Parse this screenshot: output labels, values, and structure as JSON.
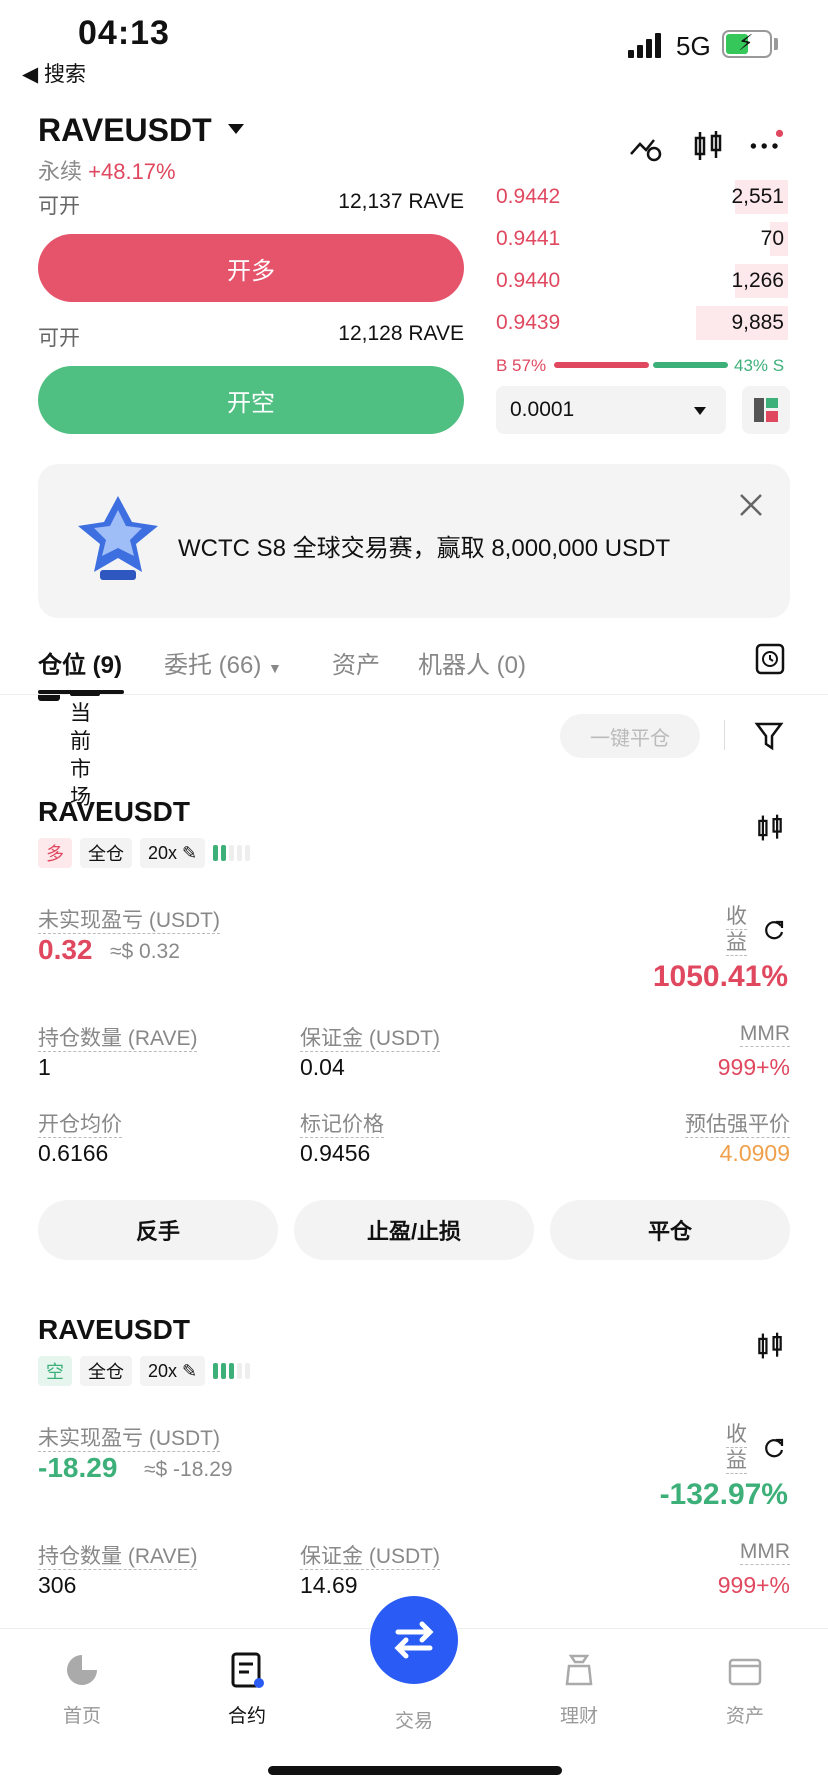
{
  "status_bar": {
    "time": "04:13",
    "back": "◀ 搜索",
    "network": "5G"
  },
  "header": {
    "symbol": "RAVEUSDT",
    "type": "永续",
    "change": "+48.17%"
  },
  "trade": {
    "open_long": {
      "label": "可开",
      "value": "12,137 RAVE",
      "button": "开多"
    },
    "open_short": {
      "label": "可开",
      "value": "12,128 RAVE",
      "button": "开空"
    }
  },
  "orderbook": {
    "asks": [
      {
        "price": "0.9442",
        "qty": "2,551",
        "depth": 0.18
      },
      {
        "price": "0.9441",
        "qty": "70",
        "depth": 0.06
      },
      {
        "price": "0.9440",
        "qty": "1,266",
        "depth": 0.18
      },
      {
        "price": "0.9439",
        "qty": "9,885",
        "depth": 0.31
      }
    ],
    "buy_ratio": "B 57%",
    "sell_ratio": "43% S",
    "buy_pct": 57,
    "precision": "0.0001"
  },
  "banner": {
    "text": "WCTC S8 全球交易赛，赢取 8,000,000 USDT"
  },
  "tabs": [
    "仓位 (9)",
    "委托 (66)",
    "资产",
    "机器人 (0)"
  ],
  "filter": {
    "label": "当前市场",
    "close_all": "一键平仓"
  },
  "positions": [
    {
      "symbol": "RAVEUSDT",
      "side": "多",
      "margin_mode": "全仓",
      "leverage": "20x",
      "pnl_label": "未实现盈亏 (USDT)",
      "pnl": "0.32",
      "pnl_usd": "≈$ 0.32",
      "roe_label": "收益",
      "roe": "1050.41%",
      "qty_label": "持仓数量 (RAVE)",
      "qty": "1",
      "margin_label": "保证金 (USDT)",
      "margin": "0.04",
      "mmr_label": "MMR",
      "mmr": "999+%",
      "entry_label": "开仓均价",
      "entry": "0.6166",
      "mark_label": "标记价格",
      "mark": "0.9456",
      "liq_label": "预估强平价",
      "liq": "4.0909",
      "actions": [
        "反手",
        "止盈/止损",
        "平仓"
      ]
    },
    {
      "symbol": "RAVEUSDT",
      "side": "空",
      "margin_mode": "全仓",
      "leverage": "20x",
      "pnl_label": "未实现盈亏 (USDT)",
      "pnl": "-18.29",
      "pnl_usd": "≈$ -18.29",
      "roe_label": "收益",
      "roe": "-132.97%",
      "qty_label": "持仓数量 (RAVE)",
      "qty": "306",
      "margin_label": "保证金 (USDT)",
      "margin": "14.69",
      "mmr_label": "MMR",
      "mmr": "999+%"
    }
  ],
  "nav": [
    "首页",
    "合约",
    "交易",
    "理财",
    "资产"
  ],
  "colors": {
    "red": "#e0485f",
    "green": "#3db07a",
    "blue": "#2a5cf5",
    "orange": "#f0a04b"
  }
}
